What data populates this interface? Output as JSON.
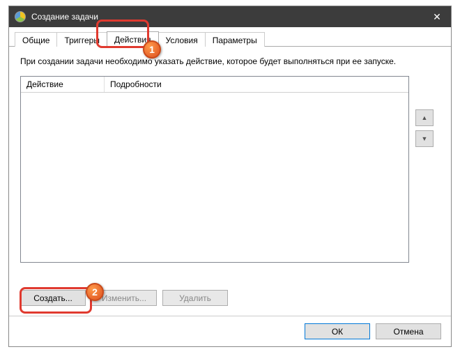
{
  "window": {
    "title": "Создание задачи"
  },
  "tabs": {
    "general": "Общие",
    "triggers": "Триггеры",
    "actions": "Действия",
    "conditions": "Условия",
    "settings": "Параметры"
  },
  "content": {
    "description": "При создании задачи необходимо указать действие, которое будет выполняться при ее запуске."
  },
  "table": {
    "col_action": "Действие",
    "col_details": "Подробности"
  },
  "buttons": {
    "create": "Создать...",
    "edit": "Изменить...",
    "delete": "Удалить"
  },
  "footer": {
    "ok": "ОК",
    "cancel": "Отмена"
  },
  "callouts": {
    "one": "1",
    "two": "2"
  }
}
